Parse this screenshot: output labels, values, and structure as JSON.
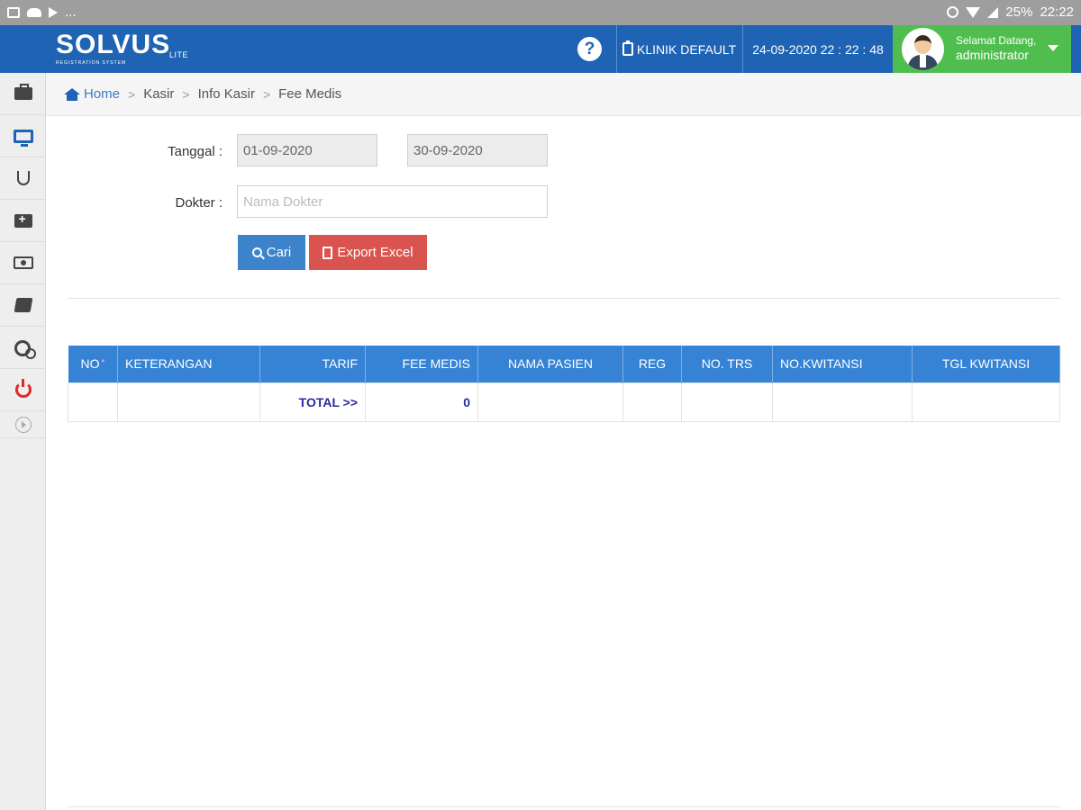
{
  "statusbar": {
    "dots": "...",
    "battery": "25%",
    "time": "22:22"
  },
  "header": {
    "brand": "SOLVUS",
    "brand_suffix": "LITE",
    "tagline": "REGISTRATION SYSTEM",
    "help_label": "?",
    "clinic": "KLINIK DEFAULT",
    "datetime": "24-09-2020 22 : 22 : 48",
    "user_greeting": "Selamat Datang,",
    "user_name": "administrator",
    "brand_color": "#1f63b4",
    "user_box_color": "#4fbe4f"
  },
  "sidebar": {
    "items": [
      {
        "icon": "briefcase-icon"
      },
      {
        "icon": "monitor-icon"
      },
      {
        "icon": "stethoscope-icon"
      },
      {
        "icon": "medkit-icon"
      },
      {
        "icon": "money-icon"
      },
      {
        "icon": "book-icon"
      },
      {
        "icon": "gears-icon"
      },
      {
        "icon": "power-icon"
      },
      {
        "icon": "expand-icon"
      }
    ]
  },
  "breadcrumb": {
    "home": "Home",
    "items": [
      "Kasir",
      "Info Kasir",
      "Fee Medis"
    ],
    "separator": ">"
  },
  "form": {
    "tanggal_label": "Tanggal :",
    "date_from": "01-09-2020",
    "date_to": "30-09-2020",
    "dokter_label": "Dokter :",
    "dokter_placeholder": "Nama Dokter",
    "dokter_value": "",
    "search_button": "Cari",
    "export_button": "Export Excel"
  },
  "table": {
    "columns": [
      "NO",
      "KETERANGAN",
      "TARIF",
      "FEE MEDIS",
      "NAMA PASIEN",
      "REG",
      "NO. TRS",
      "NO.KWITANSI",
      "TGL KWITANSI"
    ],
    "sort_marker": "▪",
    "total_label": "TOTAL >>",
    "total_value": "0",
    "header_color": "#3683d6"
  }
}
